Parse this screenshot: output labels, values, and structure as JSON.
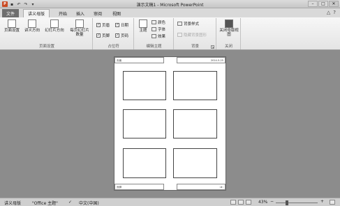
{
  "title_bar": {
    "title": "演示文稿1 - Microsoft PowerPoint",
    "app_icon_letter": "P",
    "qat": [
      "save-icon",
      "undo-icon",
      "redo-icon",
      "customize-icon"
    ],
    "controls": [
      "minimize-icon",
      "maximize-icon",
      "close-icon"
    ]
  },
  "tabs": {
    "file": "文件",
    "items": [
      "讲义母版",
      "开始",
      "插入",
      "审阅",
      "视图"
    ],
    "active": "讲义母版"
  },
  "ribbon": {
    "page_setup": {
      "label": "页面设置",
      "buttons": [
        "页面设置",
        "讲义方向",
        "幻灯片方向",
        "每页幻灯片数量"
      ]
    },
    "placeholders": {
      "label": "占位符",
      "checks": [
        {
          "text": "页眉",
          "checked": true
        },
        {
          "text": "日期",
          "checked": true
        },
        {
          "text": "页脚",
          "checked": true
        },
        {
          "text": "页码",
          "checked": true
        }
      ]
    },
    "edit_theme": {
      "label": "编辑主题",
      "theme_button": "主题",
      "colors": "颜色",
      "fonts": "字体",
      "effects": "效果"
    },
    "background": {
      "label": "背景",
      "styles": "背景样式",
      "hide_graphics": "隐藏背景图形"
    },
    "close": {
      "label": "关闭",
      "button": "关闭母版视图"
    }
  },
  "handout": {
    "header": "页眉",
    "date": "2014-5-25",
    "footer": "页脚",
    "page_number": "‹#›"
  },
  "status_bar": {
    "view": "讲义母版",
    "theme": "\"Office 主题\"",
    "language": "中文(中国)",
    "zoom": "43%",
    "zoom_value": 43
  },
  "colors": {
    "file_tab": "#6e6e6e",
    "app_icon": "#c94a23",
    "workspace": "#8c8c8c"
  }
}
